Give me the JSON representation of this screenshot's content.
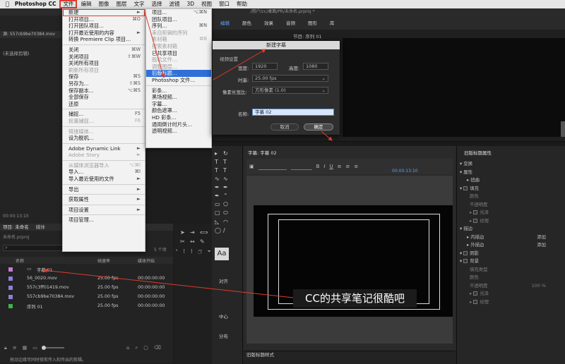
{
  "menubar": {
    "apple": "",
    "app": "Photoshop CC",
    "items": [
      "文件",
      "编辑",
      "图像",
      "图层",
      "文字",
      "选择",
      "滤镜",
      "3D",
      "视图",
      "窗口",
      "帮助"
    ]
  },
  "titlebar": {
    "path": "/用户/cc/桌面/PR/未命名.prproj *"
  },
  "source_panel": {
    "label": "源: 557cb9be70384.mov",
    "no_clip": "(未选择剪辑)",
    "timecode": "00:00:13;10"
  },
  "program_tabs": [
    "编辑",
    "颜色",
    "效果",
    "音频",
    "图形",
    "库"
  ],
  "program_header": "节目: 序列 01",
  "file_menu": {
    "items": [
      {
        "label": "新建",
        "sc": "►",
        "state": "box"
      },
      {
        "label": "打开项目...",
        "sc": "⌘O"
      },
      {
        "label": "打开团队项目..."
      },
      {
        "label": "打开最近使用的内容",
        "sc": "►"
      },
      {
        "label": "转换 Premiere Clip 项目..."
      },
      {
        "sep": true
      },
      {
        "label": "关闭",
        "sc": "⌘W"
      },
      {
        "label": "关闭项目",
        "sc": "⇧⌘W"
      },
      {
        "label": "关闭所有项目"
      },
      {
        "label": "刷新所有项目",
        "state": "dis"
      },
      {
        "label": "保存",
        "sc": "⌘S"
      },
      {
        "label": "另存为...",
        "sc": "⇧⌘S"
      },
      {
        "label": "保存副本...",
        "sc": "⌥⌘S"
      },
      {
        "label": "全部保存"
      },
      {
        "label": "还原"
      },
      {
        "sep": true
      },
      {
        "label": "捕捉...",
        "sc": "F5"
      },
      {
        "label": "批量捕捉...",
        "sc": "F6",
        "state": "dis"
      },
      {
        "sep": true
      },
      {
        "label": "链接媒体...",
        "state": "dis"
      },
      {
        "label": "设为脱机..."
      },
      {
        "sep": true
      },
      {
        "label": "Adobe Dynamic Link",
        "sc": "►"
      },
      {
        "label": "Adobe Story",
        "sc": "►",
        "state": "dis"
      },
      {
        "sep": true
      },
      {
        "label": "从媒体浏览器导入",
        "sc": "⌥⌘I",
        "state": "dis"
      },
      {
        "label": "导入...",
        "sc": "⌘I"
      },
      {
        "label": "导入最近使用的文件",
        "sc": "►"
      },
      {
        "sep": true
      },
      {
        "label": "导出",
        "sc": "►"
      },
      {
        "sep": true
      },
      {
        "label": "获取属性",
        "sc": "►"
      },
      {
        "sep": true
      },
      {
        "label": "项目设置",
        "sc": "►"
      },
      {
        "sep": true
      },
      {
        "label": "项目管理..."
      }
    ]
  },
  "new_menu": {
    "items": [
      {
        "label": "项目...",
        "sc": "⌥⌘N"
      },
      {
        "label": "团队项目..."
      },
      {
        "label": "序列...",
        "sc": "⌘N"
      },
      {
        "label": "来自剪辑的序列",
        "state": "dis"
      },
      {
        "label": "素材箱",
        "sc": "⌘B",
        "state": "dis"
      },
      {
        "label": "搜索素材箱",
        "state": "dis"
      },
      {
        "label": "已共享项目"
      },
      {
        "label": "脱机文件...",
        "state": "dis"
      },
      {
        "label": "调整图层...",
        "state": "dis"
      },
      {
        "label": "旧版标题...",
        "state": "hl"
      },
      {
        "label": "Photoshop 文件..."
      },
      {
        "sep": true
      },
      {
        "label": "彩条..."
      },
      {
        "label": "黑场视频..."
      },
      {
        "label": "字幕..."
      },
      {
        "label": "颜色遮罩..."
      },
      {
        "label": "HD 彩条..."
      },
      {
        "label": "通用倒计时片头..."
      },
      {
        "label": "透明视频..."
      }
    ]
  },
  "dialog": {
    "title": "新建字幕",
    "video_settings": "视频设置",
    "width_label": "宽度:",
    "width": "1920",
    "height_label": "高度:",
    "height": "1080",
    "timebase_label": "时基:",
    "timebase": "25.00 fps",
    "par_label": "像素长宽比:",
    "par": "方形像素 (1.0)",
    "name_label": "名称:",
    "name": "字幕 02",
    "cancel": "取消",
    "ok": "确定"
  },
  "project_panel": {
    "tab": "项目: 未命名",
    "tab2": "媒体",
    "file": "未命名.prproj",
    "count": "5 个项",
    "col_name": "名称",
    "col_fps": "帧速率",
    "col_start": "媒体开始",
    "rows": [
      {
        "name": "字幕 01",
        "fps": "",
        "start": "",
        "color": "#c77bd6"
      },
      {
        "name": "56_0020.mov",
        "fps": "25.00 fps",
        "start": "00:00:00:00",
        "color": "#8a7fdc"
      },
      {
        "name": "557c3ff01419.mov",
        "fps": "25.00 fps",
        "start": "00:00:00:00",
        "color": "#8a7fdc"
      },
      {
        "name": "557cb9be70384.mov",
        "fps": "25.00 fps",
        "start": "00:00:00:00",
        "color": "#8a7fdc"
      },
      {
        "name": "序列 01",
        "fps": "25.00 fps",
        "start": "00:00:00:00",
        "color": "#3fb54a"
      }
    ]
  },
  "status": "拖动边缘可同时修剪传入和传出的剪辑。",
  "editor": {
    "title_tab": "字幕: 字幕 02",
    "timecode": "00:00:13:10",
    "props_header": "旧版标题属性",
    "styles_header": "旧版标题样式",
    "align_label": "对齐",
    "center_label": "中心",
    "distribute_label": "分布",
    "aa_label": "Aa",
    "props": [
      {
        "label": "变换",
        "kind": "group"
      },
      {
        "label": "属性",
        "kind": "group"
      },
      {
        "label": "扭曲",
        "kind": "sub"
      },
      {
        "label": "填充",
        "kind": "check"
      },
      {
        "label": "颜色",
        "kind": "dim"
      },
      {
        "label": "不透明度",
        "kind": "dim"
      },
      {
        "label": "光泽",
        "kind": "subcheck"
      },
      {
        "label": "纹理",
        "kind": "subcheck"
      },
      {
        "label": "描边",
        "kind": "group"
      },
      {
        "label": "内描边",
        "kind": "sub",
        "right": "添加"
      },
      {
        "label": "外描边",
        "kind": "sub",
        "right": "添加"
      },
      {
        "label": "阴影",
        "kind": "check"
      },
      {
        "label": "背景",
        "kind": "check"
      },
      {
        "label": "填充类型",
        "kind": "dim"
      },
      {
        "label": "颜色",
        "kind": "dim"
      },
      {
        "label": "不透明度",
        "kind": "dim",
        "right": "100 %"
      },
      {
        "label": "光泽",
        "kind": "subcheck"
      },
      {
        "label": "纹理",
        "kind": "subcheck"
      }
    ]
  },
  "annotation": "CC的共享笔记很酷吧",
  "colors": {
    "accent": "#e03b2a",
    "highlight": "#2f6fd8",
    "panel": "#232323"
  }
}
